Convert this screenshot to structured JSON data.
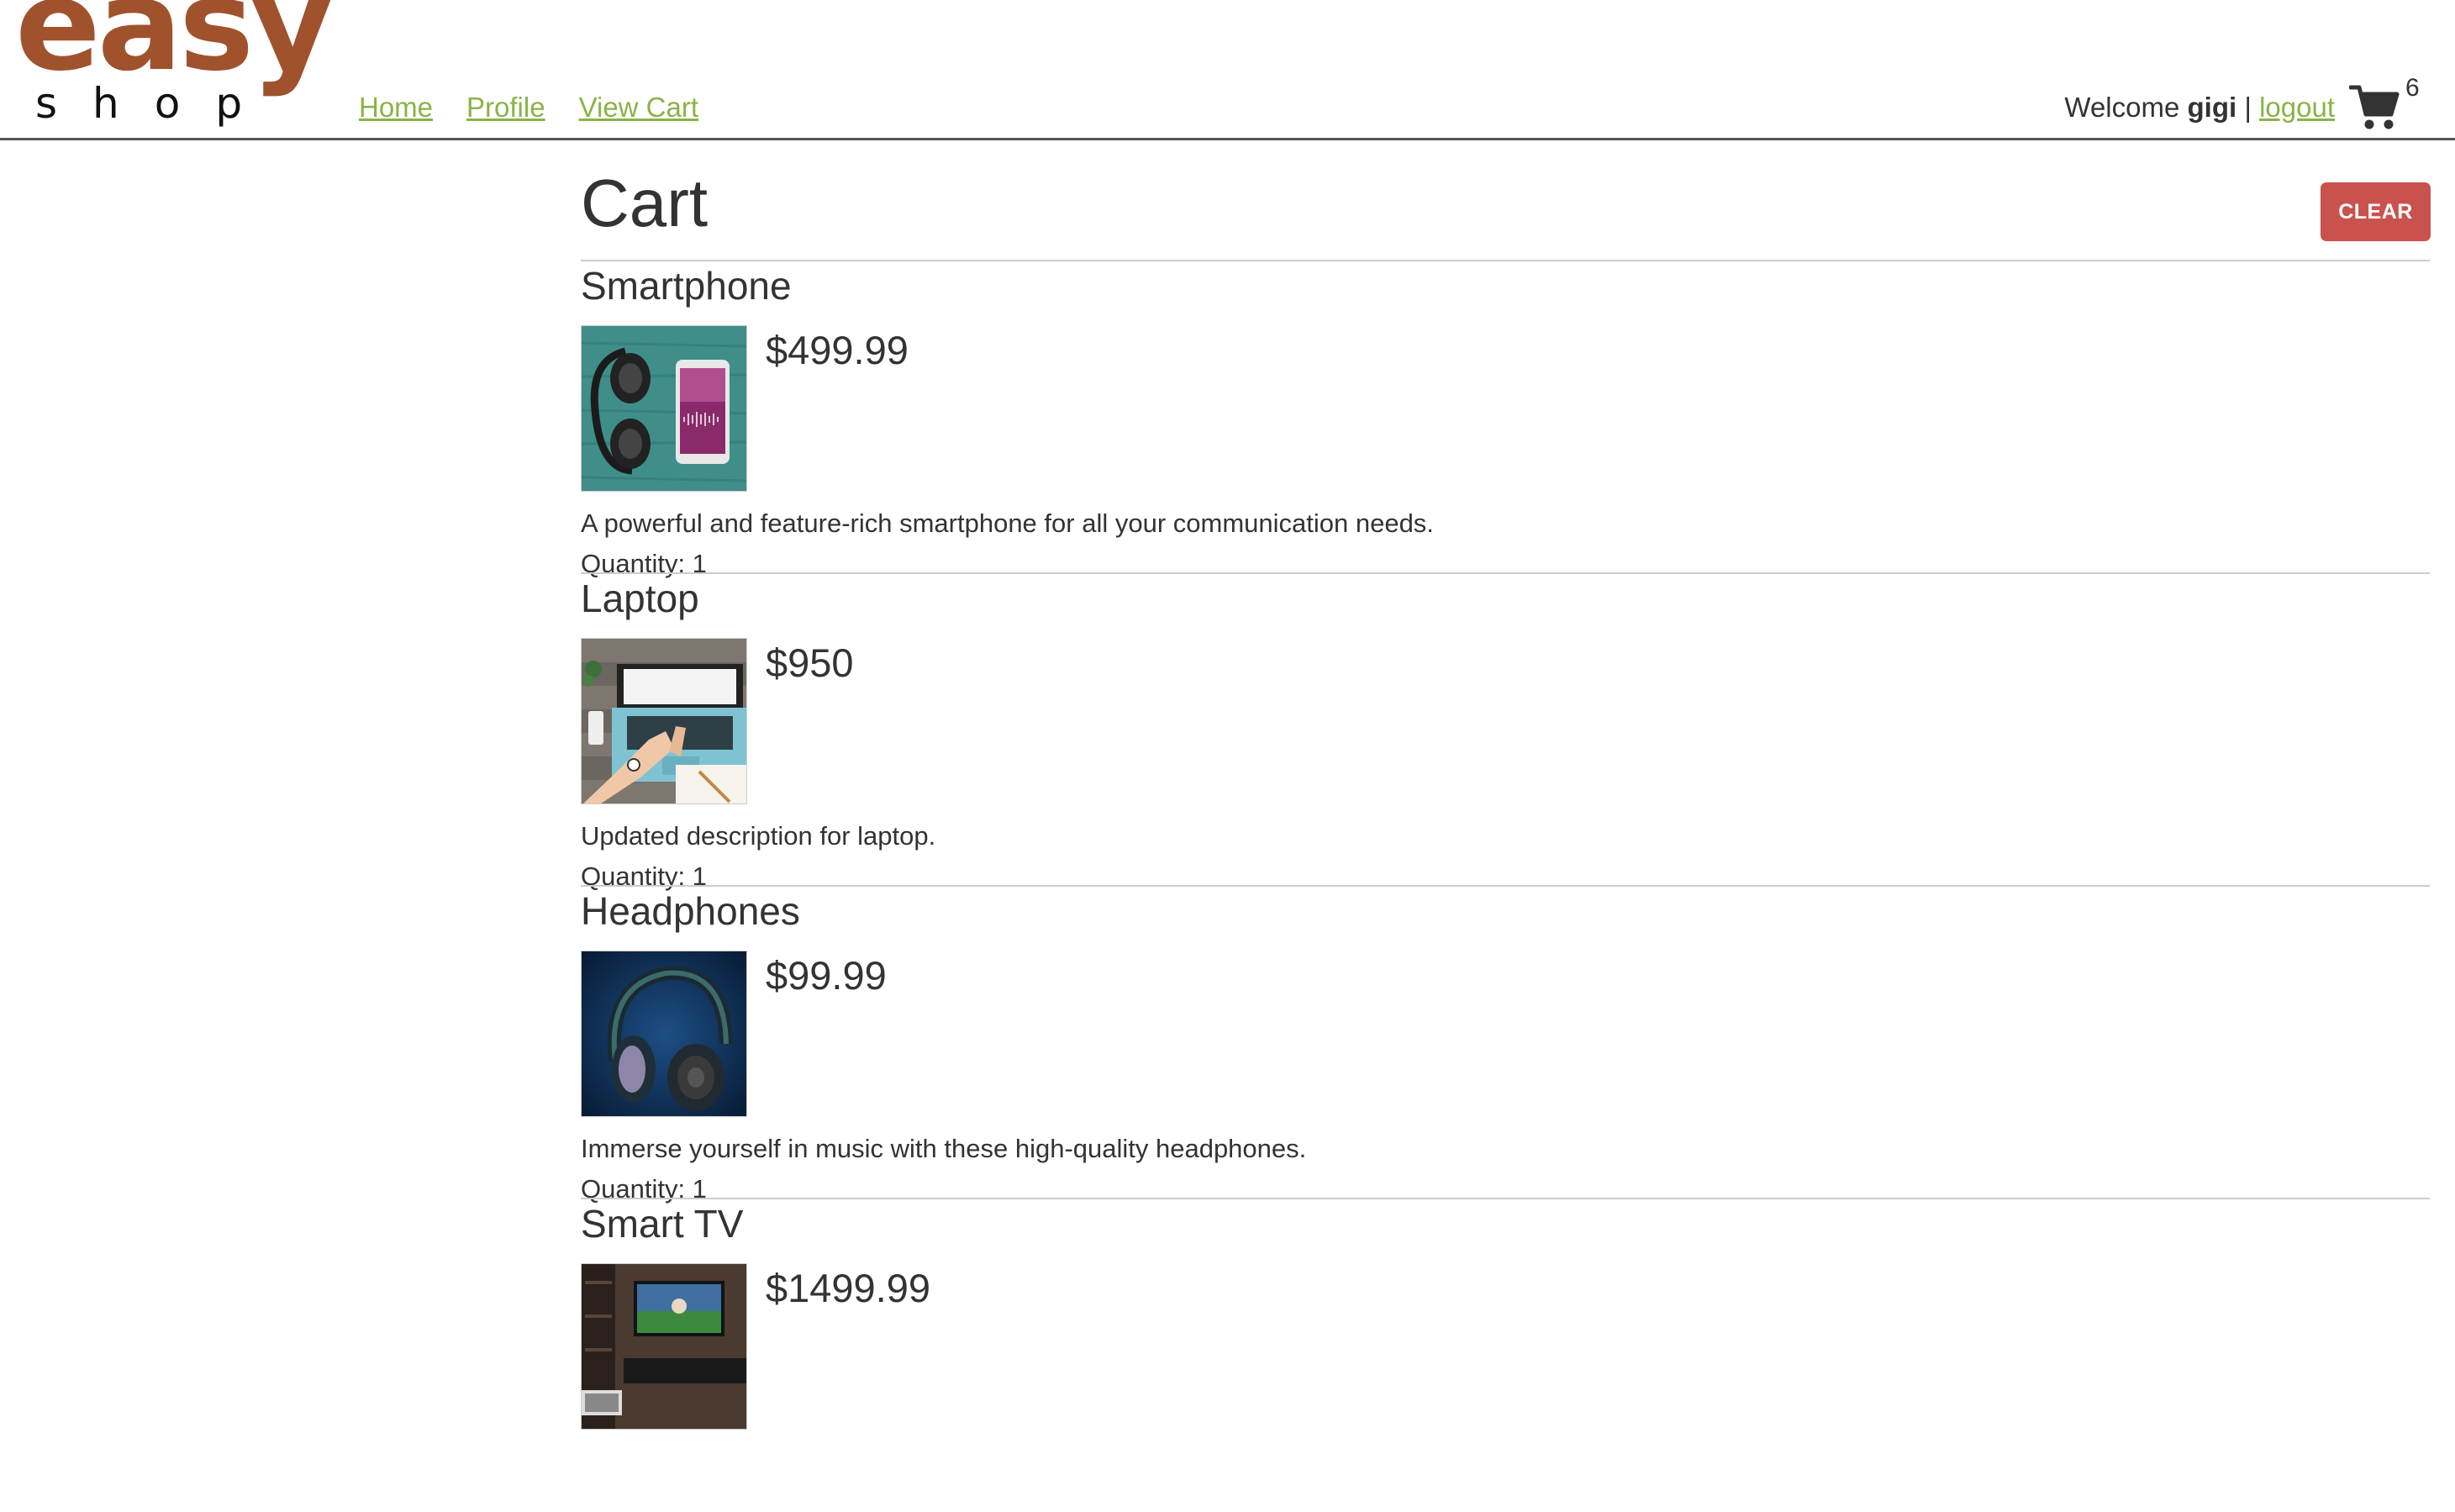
{
  "header": {
    "logo": {
      "word_top": "easy",
      "word_bottom": "shop",
      "color": "#a0522d"
    },
    "nav": [
      {
        "label": "Home"
      },
      {
        "label": "Profile"
      },
      {
        "label": "View Cart"
      }
    ],
    "user": {
      "welcome_text": "Welcome",
      "username": "gigi",
      "separator": "|",
      "logout_label": "logout"
    },
    "cart": {
      "icon": "cart-icon",
      "count": "6"
    },
    "link_color": "#8ab347"
  },
  "cart_page": {
    "title": "Cart",
    "clear_label": "CLEAR",
    "clear_color": "#c9524d",
    "items": [
      {
        "name": "Smartphone",
        "price": "$499.99",
        "description": "A powerful and feature-rich smartphone for all your communication needs.",
        "quantity_text": "Quantity: 1",
        "image": "smartphone-headphones-photo"
      },
      {
        "name": "Laptop",
        "price": "$950",
        "description": "Updated description for laptop.",
        "quantity_text": "Quantity: 1",
        "image": "laptop-desk-photo"
      },
      {
        "name": "Headphones",
        "price": "$99.99",
        "description": "Immerse yourself in music with these high-quality headphones.",
        "quantity_text": "Quantity: 1",
        "image": "headphones-photo"
      },
      {
        "name": "Smart TV",
        "price": "$1499.99",
        "description": "",
        "quantity_text": "",
        "image": "smart-tv-room-photo"
      }
    ]
  }
}
